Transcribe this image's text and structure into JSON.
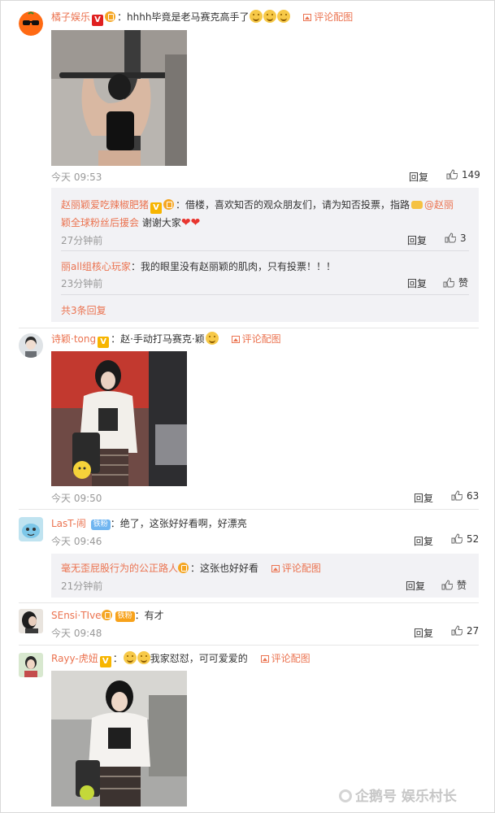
{
  "comments": [
    {
      "username": "橘子娱乐",
      "text_prefix": "：hhhh毕竟是老马赛克高手了",
      "pic_link": "评论配图",
      "time": "今天 09:53",
      "reply_label": "回复",
      "like_count": "149",
      "replies": [
        {
          "username": "赵丽颖爱吃辣椒肥猪",
          "text_a": "：借楼，喜欢知否的观众朋友们，请为知否投票，指路",
          "mention_a": "@赵丽",
          "mention_b": "颖全球粉丝后援会",
          "text_b": "谢谢大家",
          "time": "27分钟前",
          "reply_label": "回复",
          "like_count": "3"
        },
        {
          "username": "丽all组核心玩家",
          "text": "：我的眼里没有赵丽颖的肌肉，只有投票！！！",
          "time": "23分钟前",
          "reply_label": "回复",
          "like_count": "赞"
        }
      ],
      "more_replies": "共3条回复"
    },
    {
      "username": "诗颖·tong",
      "text": "：赵·手动打马赛克·颖",
      "pic_link": "评论配图",
      "time": "今天 09:50",
      "reply_label": "回复",
      "like_count": "63"
    },
    {
      "username": "LasT-闹",
      "fan_badge": "铁粉",
      "text": "：绝了，这张好好看啊，好漂亮",
      "time": "今天 09:46",
      "reply_label": "回复",
      "like_count": "52",
      "replies": [
        {
          "username": "毫无歪屁股行为的公正路人",
          "text": "：这张也好好看",
          "pic_link": "评论配图",
          "time": "21分钟前",
          "reply_label": "回复",
          "like_count": "赞"
        }
      ]
    },
    {
      "username": "SEnsi·TIve",
      "fan_badge": "铁粉",
      "text": "：有才",
      "time": "今天 09:48",
      "reply_label": "回复",
      "like_count": "27"
    },
    {
      "username": "Rayy-虎妞",
      "text": "我家怼怼，可可爱爱的",
      "pic_link": "评论配图"
    }
  ],
  "watermark": "企鹅号 娱乐村长",
  "colors": {
    "link": "#eb7350",
    "muted": "#999999",
    "reply_bg": "#f2f2f5"
  }
}
